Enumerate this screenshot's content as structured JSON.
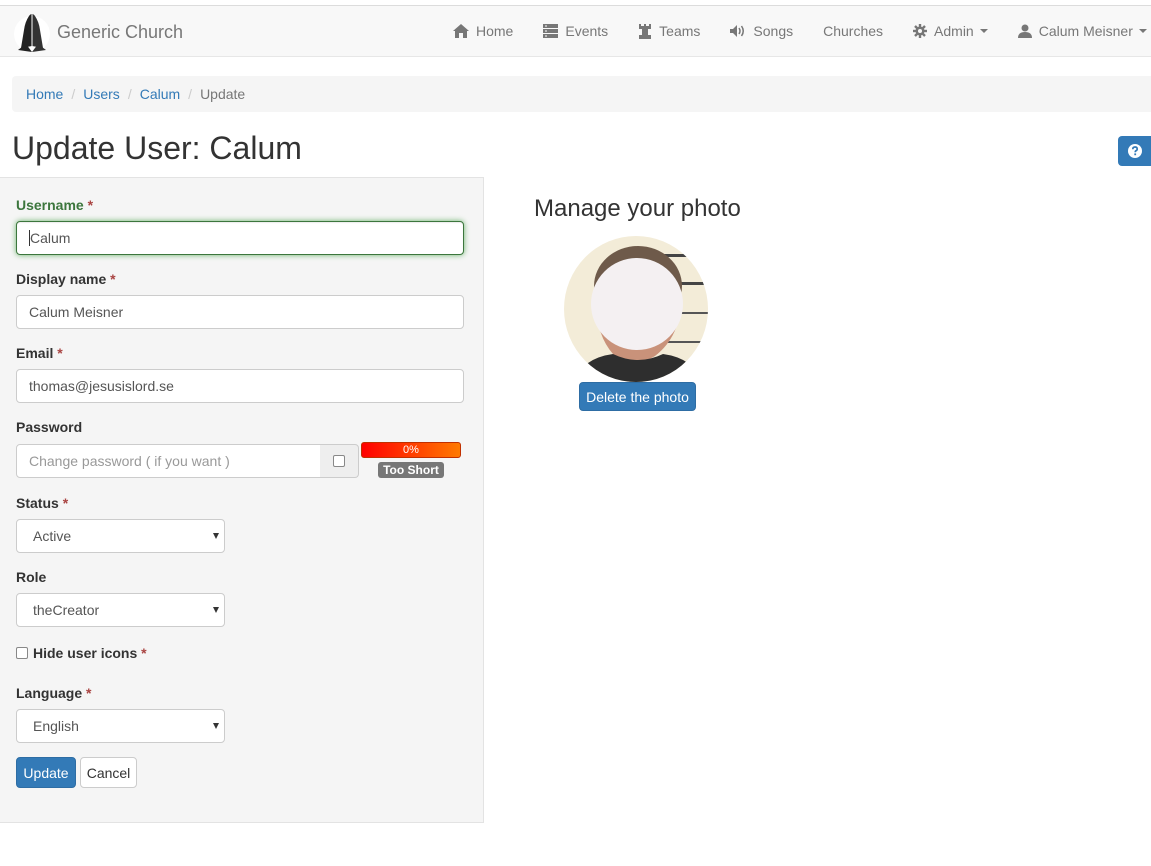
{
  "brand": {
    "name": "Generic Church"
  },
  "nav": {
    "items": [
      {
        "label": "Home",
        "icon": "home-icon"
      },
      {
        "label": "Events",
        "icon": "server-icon"
      },
      {
        "label": "Teams",
        "icon": "tower-icon"
      },
      {
        "label": "Songs",
        "icon": "volume-icon"
      },
      {
        "label": "Churches"
      },
      {
        "label": "Admin",
        "icon": "cog-icon",
        "dropdown": true
      },
      {
        "label": "Calum Meisner",
        "icon": "user-icon",
        "dropdown": true
      }
    ]
  },
  "breadcrumb": {
    "items": [
      "Home",
      "Users",
      "Calum"
    ],
    "active": "Update",
    "separator": "/"
  },
  "page": {
    "title": "Update User: Calum"
  },
  "form": {
    "required_mark": "*",
    "username": {
      "label": "Username",
      "value": "Calum"
    },
    "display_name": {
      "label": "Display name",
      "value": "Calum Meisner"
    },
    "email": {
      "label": "Email",
      "value": "thomas@jesusislord.se"
    },
    "password": {
      "label": "Password",
      "placeholder": "Change password ( if you want )",
      "strength_text": "0%",
      "strength_value": 0,
      "strength_label": "Too Short"
    },
    "status": {
      "label": "Status",
      "value": "Active"
    },
    "role": {
      "label": "Role",
      "value": "theCreator"
    },
    "hide_icons": {
      "label": "Hide user icons",
      "checked": false
    },
    "language": {
      "label": "Language",
      "value": "English"
    },
    "update_label": "Update",
    "cancel_label": "Cancel"
  },
  "photo": {
    "title": "Manage your photo",
    "delete_label": "Delete the photo"
  },
  "colors": {
    "primary": "#337ab7",
    "success": "#3c763d",
    "required": "#a94442",
    "navbar": "#f8f8f8",
    "panel": "#f5f5f5"
  }
}
